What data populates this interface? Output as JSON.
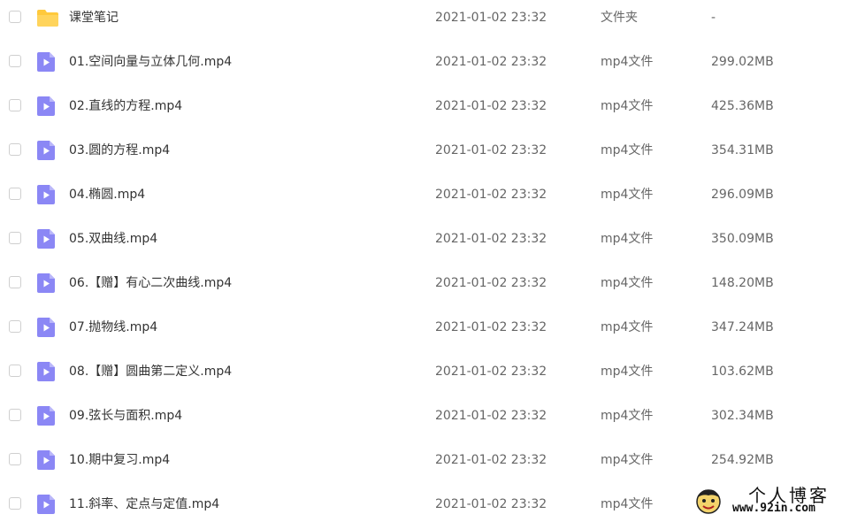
{
  "files": [
    {
      "name": "课堂笔记",
      "date": "2021-01-02 23:32",
      "type": "文件夹",
      "size": "-",
      "icon": "folder-icon"
    },
    {
      "name": "01.空间向量与立体几何.mp4",
      "date": "2021-01-02 23:32",
      "type": "mp4文件",
      "size": "299.02MB",
      "icon": "video-file-icon"
    },
    {
      "name": "02.直线的方程.mp4",
      "date": "2021-01-02 23:32",
      "type": "mp4文件",
      "size": "425.36MB",
      "icon": "video-file-icon"
    },
    {
      "name": "03.圆的方程.mp4",
      "date": "2021-01-02 23:32",
      "type": "mp4文件",
      "size": "354.31MB",
      "icon": "video-file-icon"
    },
    {
      "name": "04.椭圆.mp4",
      "date": "2021-01-02 23:32",
      "type": "mp4文件",
      "size": "296.09MB",
      "icon": "video-file-icon"
    },
    {
      "name": "05.双曲线.mp4",
      "date": "2021-01-02 23:32",
      "type": "mp4文件",
      "size": "350.09MB",
      "icon": "video-file-icon"
    },
    {
      "name": "06.【赠】有心二次曲线.mp4",
      "date": "2021-01-02 23:32",
      "type": "mp4文件",
      "size": "148.20MB",
      "icon": "video-file-icon"
    },
    {
      "name": "07.抛物线.mp4",
      "date": "2021-01-02 23:32",
      "type": "mp4文件",
      "size": "347.24MB",
      "icon": "video-file-icon"
    },
    {
      "name": "08.【赠】圆曲第二定义.mp4",
      "date": "2021-01-02 23:32",
      "type": "mp4文件",
      "size": "103.62MB",
      "icon": "video-file-icon"
    },
    {
      "name": "09.弦长与面积.mp4",
      "date": "2021-01-02 23:32",
      "type": "mp4文件",
      "size": "302.34MB",
      "icon": "video-file-icon"
    },
    {
      "name": "10.期中复习.mp4",
      "date": "2021-01-02 23:32",
      "type": "mp4文件",
      "size": "254.92MB",
      "icon": "video-file-icon"
    },
    {
      "name": "11.斜率、定点与定值.mp4",
      "date": "2021-01-02 23:32",
      "type": "mp4文件",
      "size": "",
      "icon": "video-file-icon"
    }
  ],
  "watermark": {
    "title": "个人博客",
    "url": "www.92in.com"
  },
  "colors": {
    "folder": "#ffc93c",
    "video_icon": "#8b87f5",
    "video_icon_fold": "#b9b6fa",
    "text_primary": "#333333",
    "text_secondary": "#666666"
  }
}
